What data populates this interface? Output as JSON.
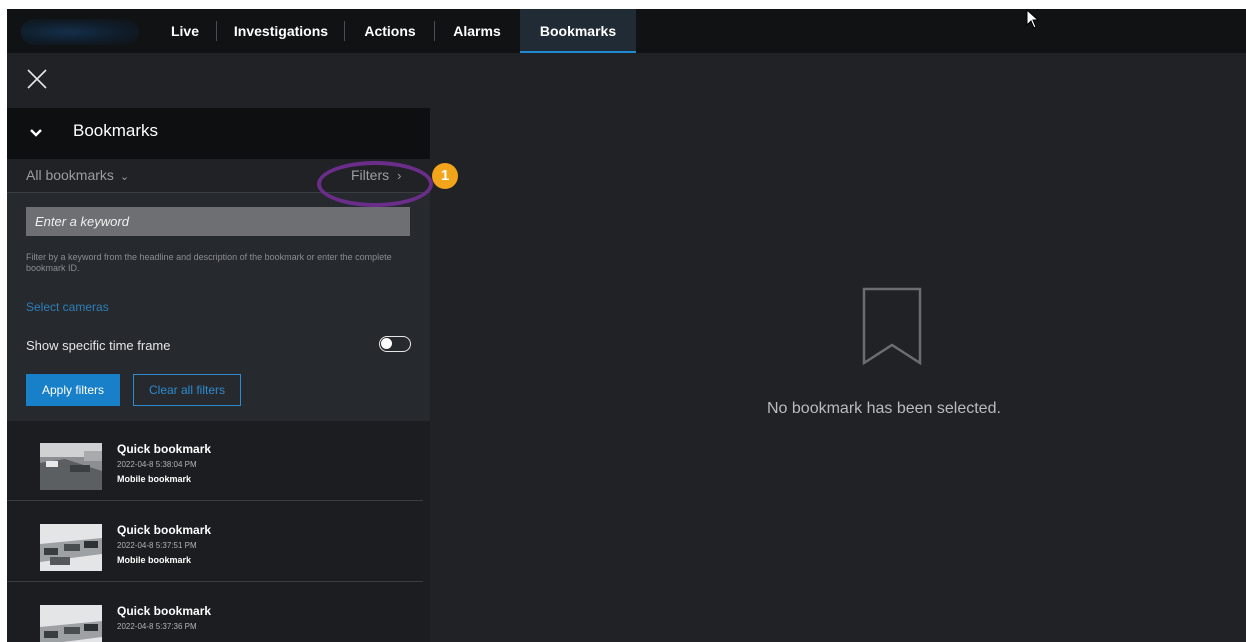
{
  "nav": {
    "tabs": [
      {
        "label": "Live"
      },
      {
        "label": "Investigations"
      },
      {
        "label": "Actions"
      },
      {
        "label": "Alarms"
      },
      {
        "label": "Bookmarks",
        "active": true
      }
    ]
  },
  "panel": {
    "title": "Bookmarks",
    "all_bookmarks_label": "All bookmarks",
    "filters_label": "Filters",
    "callout_number": "1",
    "keyword_placeholder": "Enter a keyword",
    "hint": "Filter by a keyword from the headline and description of the bookmark or enter the complete bookmark ID.",
    "select_cameras": "Select cameras",
    "time_frame_label": "Show specific time frame",
    "time_frame_enabled": false,
    "apply_label": "Apply filters",
    "clear_label": "Clear all filters"
  },
  "bookmarks": [
    {
      "title": "Quick bookmark",
      "time": "2022-04-8 5:38:04 PM",
      "subtitle": "Mobile bookmark"
    },
    {
      "title": "Quick bookmark",
      "time": "2022-04-8 5:37:51 PM",
      "subtitle": "Mobile bookmark"
    },
    {
      "title": "Quick bookmark",
      "time": "2022-04-8 5:37:36 PM",
      "subtitle": ""
    }
  ],
  "main": {
    "empty_message": "No bookmark has been selected."
  },
  "colors": {
    "accent": "#1780c8",
    "link": "#2e7fb8",
    "callout": "#f2a51a",
    "highlight": "#6a2d8a"
  }
}
